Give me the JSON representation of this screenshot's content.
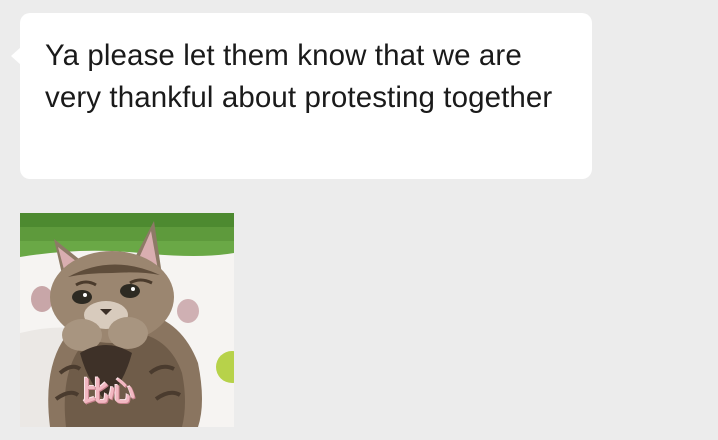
{
  "conversation": {
    "message": {
      "text": "Ya please let them know that we are very thankful about protesting together"
    },
    "sticker": {
      "icon": "cat-heart-hands-sticker",
      "caption": "比心"
    }
  }
}
